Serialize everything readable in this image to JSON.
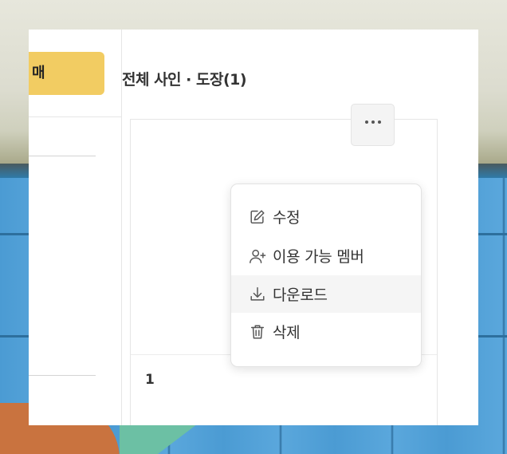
{
  "sidebar": {
    "primary_button_label": "매"
  },
  "header": {
    "title": "전체 사인 · 도장(1)"
  },
  "card": {
    "count": "1",
    "more_button_icon": "more-horizontal-icon"
  },
  "context_menu": {
    "items": [
      {
        "label": "수정",
        "icon": "edit-icon"
      },
      {
        "label": "이용 가능 멤버",
        "icon": "user-plus-icon"
      },
      {
        "label": "다운로드",
        "icon": "download-icon",
        "highlighted": true
      },
      {
        "label": "삭제",
        "icon": "trash-icon"
      }
    ]
  },
  "colors": {
    "accent_yellow": "#f2cc62",
    "menu_hover": "#f5f5f5",
    "text": "#333333"
  }
}
